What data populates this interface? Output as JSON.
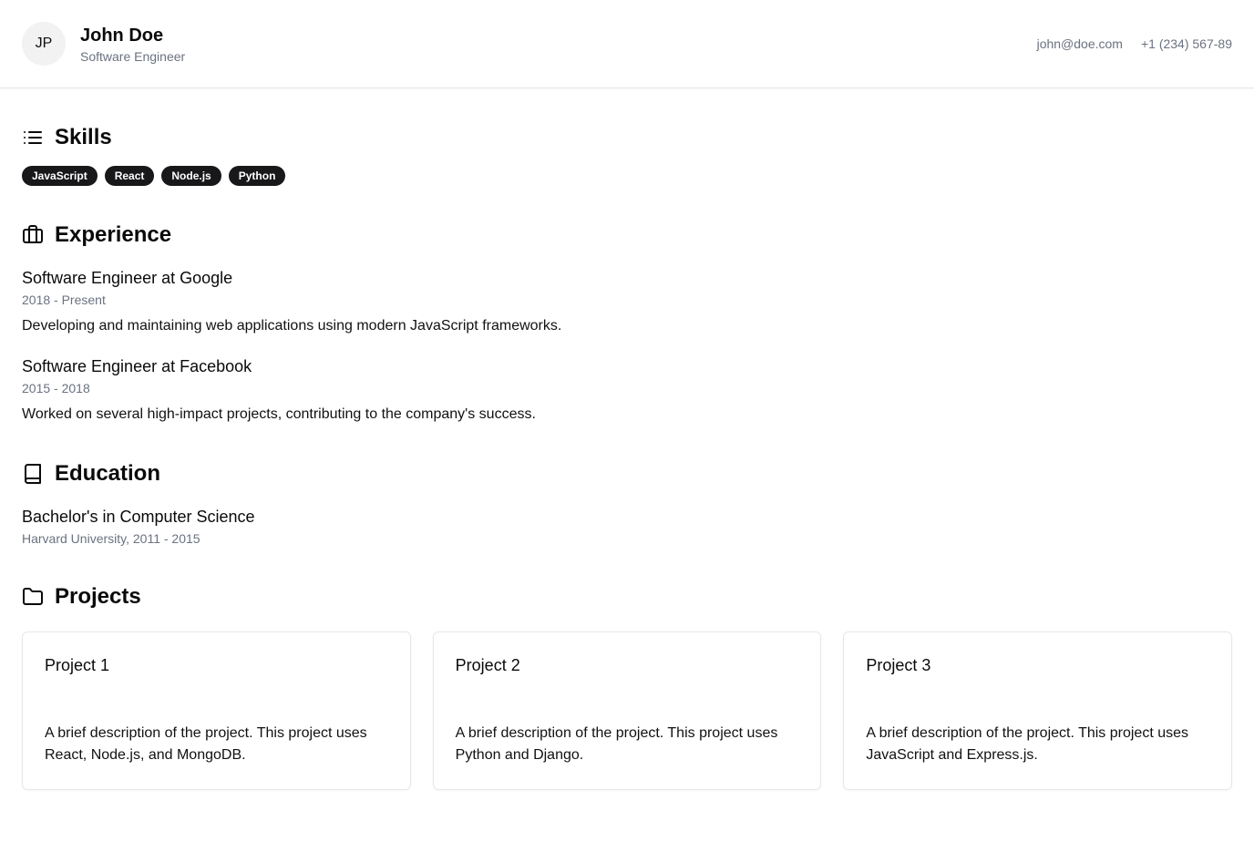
{
  "header": {
    "avatar_initials": "JP",
    "name": "John Doe",
    "role": "Software Engineer",
    "email": "john@doe.com",
    "phone": "+1 (234) 567-89"
  },
  "skills": {
    "title": "Skills",
    "icon": "list-icon",
    "items": [
      "JavaScript",
      "React",
      "Node.js",
      "Python"
    ]
  },
  "experience": {
    "title": "Experience",
    "icon": "briefcase-icon",
    "jobs": [
      {
        "title": "Software Engineer at Google",
        "dates": "2018 - Present",
        "description": "Developing and maintaining web applications using modern JavaScript frameworks."
      },
      {
        "title": "Software Engineer at Facebook",
        "dates": "2015 - 2018",
        "description": "Worked on several high-impact projects, contributing to the company's success."
      }
    ]
  },
  "education": {
    "title": "Education",
    "icon": "book-icon",
    "degree": "Bachelor's in Computer Science",
    "school": "Harvard University, 2011 - 2015"
  },
  "projects": {
    "title": "Projects",
    "icon": "folder-icon",
    "items": [
      {
        "title": "Project 1",
        "description": "A brief description of the project. This project uses React, Node.js, and MongoDB."
      },
      {
        "title": "Project 2",
        "description": "A brief description of the project. This project uses Python and Django."
      },
      {
        "title": "Project 3",
        "description": "A brief description of the project. This project uses JavaScript and Express.js."
      }
    ]
  },
  "colors": {
    "badge_bg": "#18181b",
    "muted_text": "#6b7280",
    "border": "#e5e7eb"
  }
}
